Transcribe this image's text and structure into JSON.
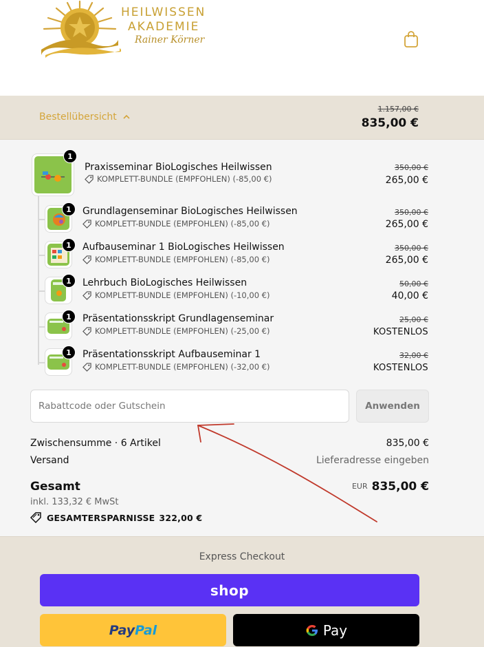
{
  "brand": {
    "line1": "HEILWISSEN",
    "line2": "AKADEMIE",
    "line3": "Rainer Körner",
    "accent": "#d4a53a"
  },
  "summary": {
    "toggle_label": "Bestellübersicht",
    "old_total": "1.157,00 €",
    "total": "835,00 €"
  },
  "items": [
    {
      "name": "Praxisseminar BioLogisches Heilwissen",
      "qty": "1",
      "bundle": "KOMPLETT-BUNDLE (EMPFOHLEN) (-85,00 €)",
      "old": "350,00 €",
      "price": "265,00 €"
    },
    {
      "name": "Grundlagenseminar BioLogisches Heilwissen",
      "qty": "1",
      "bundle": "KOMPLETT-BUNDLE (EMPFOHLEN) (-85,00 €)",
      "old": "350,00 €",
      "price": "265,00 €"
    },
    {
      "name": "Aufbauseminar 1 BioLogisches Heilwissen",
      "qty": "1",
      "bundle": "KOMPLETT-BUNDLE (EMPFOHLEN) (-85,00 €)",
      "old": "350,00 €",
      "price": "265,00 €"
    },
    {
      "name": "Lehrbuch BioLogisches Heilwissen",
      "qty": "1",
      "bundle": "KOMPLETT-BUNDLE (EMPFOHLEN) (-10,00 €)",
      "old": "50,00 €",
      "price": "40,00 €"
    },
    {
      "name": "Präsentationsskript Grundlagenseminar",
      "qty": "1",
      "bundle": "KOMPLETT-BUNDLE (EMPFOHLEN) (-25,00 €)",
      "old": "25,00 €",
      "price": "KOSTENLOS"
    },
    {
      "name": "Präsentationsskript Aufbauseminar 1",
      "qty": "1",
      "bundle": "KOMPLETT-BUNDLE (EMPFOHLEN) (-32,00 €)",
      "old": "32,00 €",
      "price": "KOSTENLOS"
    }
  ],
  "discount": {
    "placeholder": "Rabattcode oder Gutschein",
    "apply_label": "Anwenden"
  },
  "totals": {
    "subtotal_label": "Zwischensumme · 6 Artikel",
    "subtotal_value": "835,00 €",
    "shipping_label": "Versand",
    "shipping_value": "Lieferadresse eingeben",
    "total_label": "Gesamt",
    "currency": "EUR",
    "total_value": "835,00 €",
    "tax": "inkl. 133,32 € MwSt",
    "savings_label": "GESAMTERSPARNISSE",
    "savings_value": "322,00 €"
  },
  "express": {
    "title": "Express Checkout",
    "shop_label": "shop",
    "paypal_part1": "Pay",
    "paypal_part2": "Pal",
    "gpay_label": "Pay"
  }
}
